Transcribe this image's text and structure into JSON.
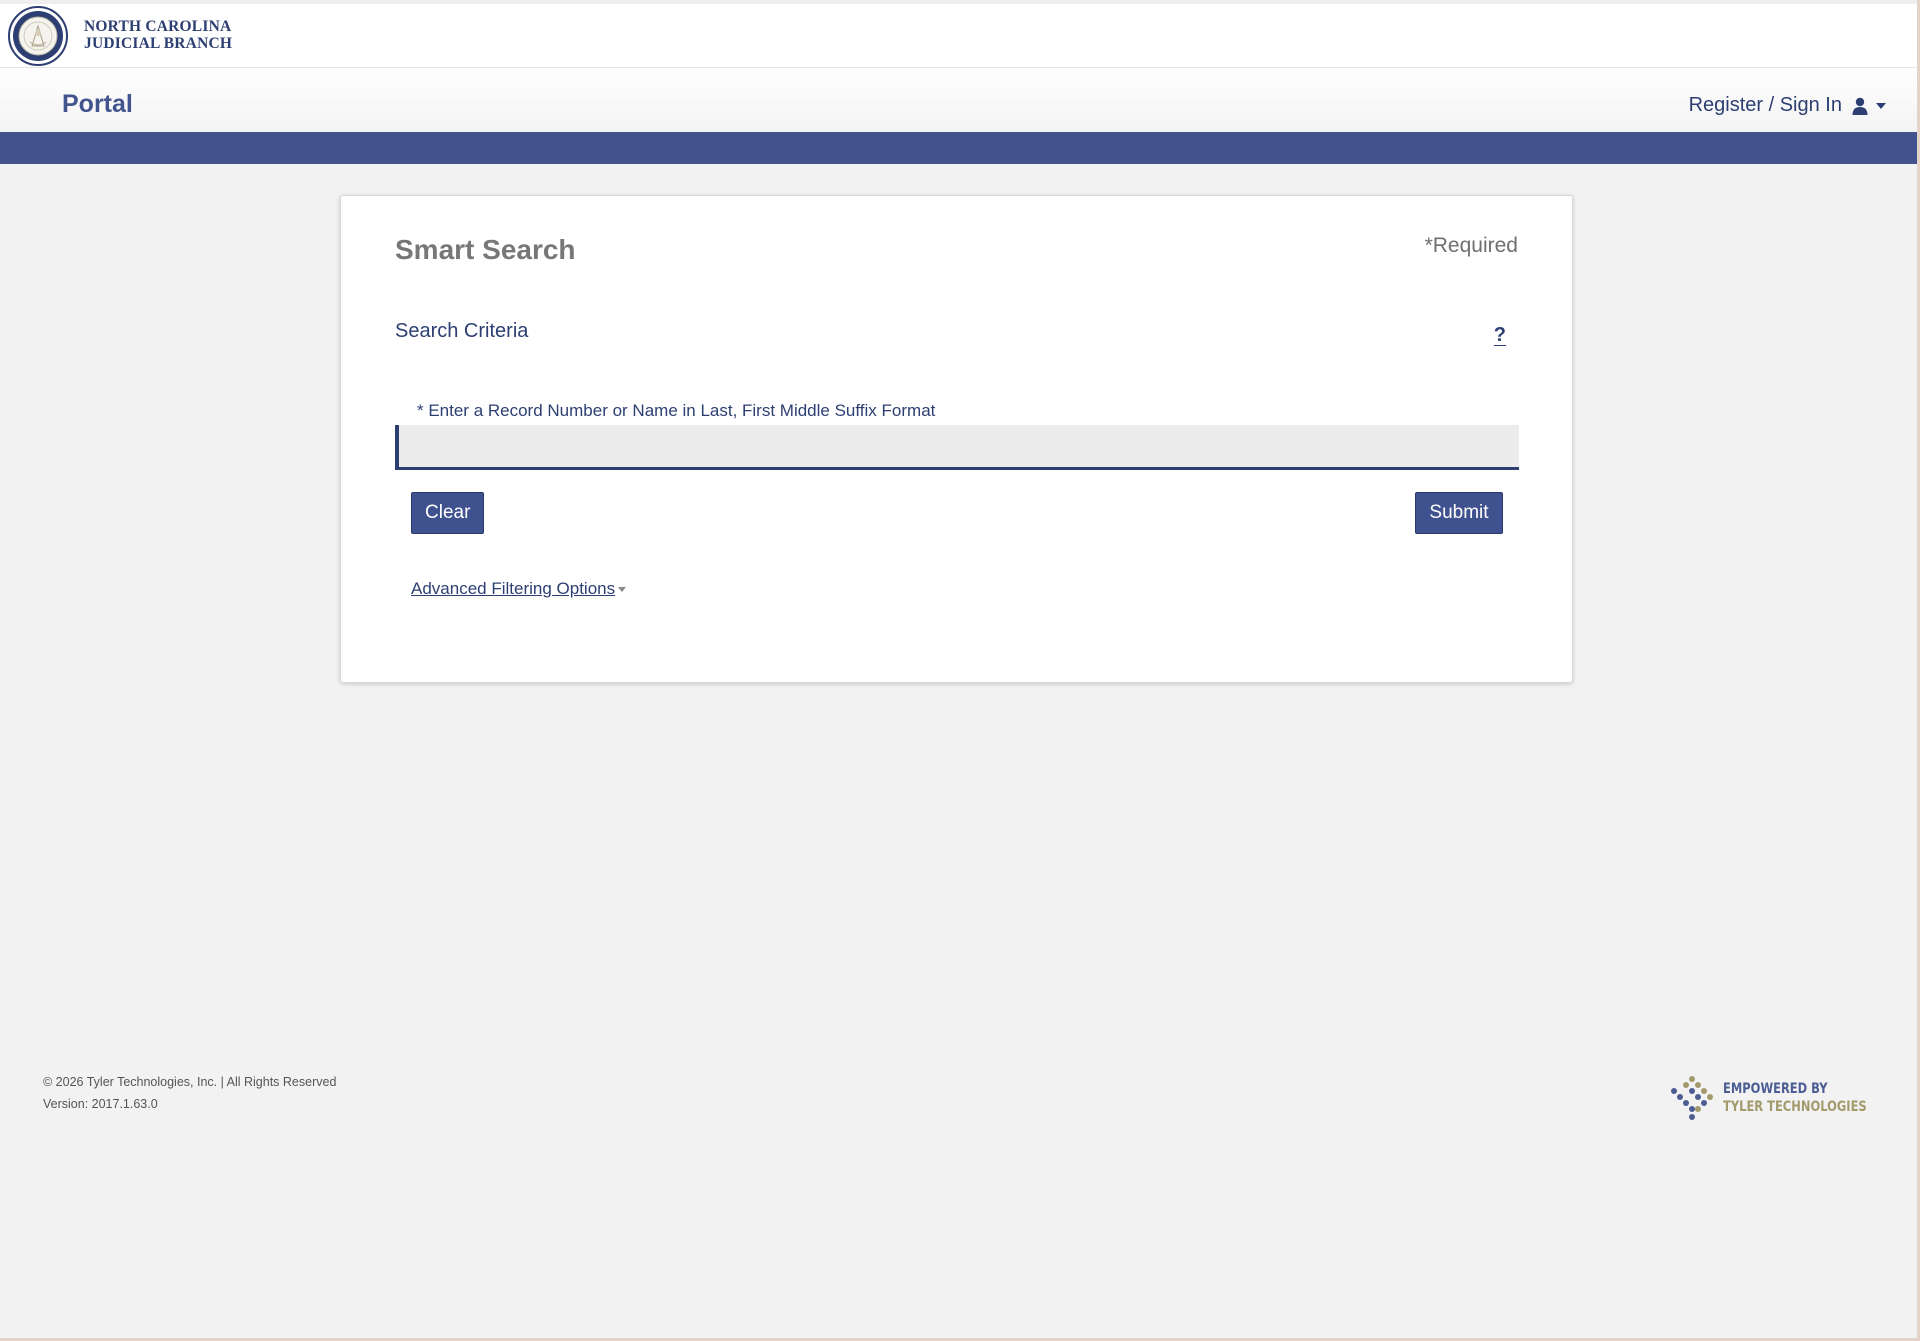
{
  "brand": {
    "line1": "NORTH CAROLINA",
    "line2": "JUDICIAL BRANCH"
  },
  "nav": {
    "portal_title": "Portal",
    "sign_in_label": "Register / Sign In"
  },
  "search": {
    "title": "Smart Search",
    "required_note": "*Required",
    "criteria_label": "Search Criteria",
    "help_label": "?",
    "field_label": "* Enter a Record Number or Name in Last, First Middle Suffix Format",
    "input_value": "",
    "input_placeholder": "",
    "clear_label": "Clear",
    "submit_label": "Submit",
    "advanced_label": "Advanced Filtering Options"
  },
  "footer": {
    "copyright": "© 2026 Tyler Technologies, Inc. | All Rights Reserved",
    "version": "Version: 2017.1.63.0",
    "logo_line1": "EMPOWERED BY",
    "logo_line2": "TYLER TECHNOLOGIES"
  },
  "colors": {
    "primary": "#42528c",
    "text_dark_blue": "#2d3f72",
    "background": "#f2f2f2",
    "logo_gold": "#a39a6c"
  },
  "icons": {
    "seal": "court-seal-icon",
    "user": "user-icon",
    "caret": "caret-down-icon",
    "help": "question-mark-icon"
  }
}
